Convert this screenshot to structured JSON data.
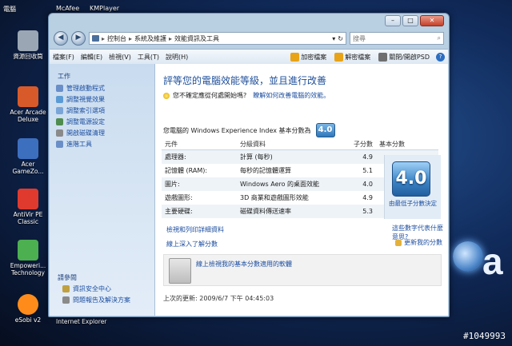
{
  "desktop": {
    "top_labels": [
      "電腦",
      "McAfee",
      "KMPlayer"
    ],
    "icons": [
      {
        "label": "資源回收筒",
        "color": "#9aa6b3"
      },
      {
        "label": "Acer Arcade Deluxe",
        "color": "#d85a2a"
      },
      {
        "label": "Acer GameZo...",
        "color": "#3d6fbf"
      },
      {
        "label": "AntiVir PE Classic",
        "color": "#e03a2f"
      },
      {
        "label": "Empoweri... Technology",
        "color": "#4caf50"
      },
      {
        "label": "eSobi v2",
        "color": "#ff8c1a"
      }
    ],
    "bottom_icon_label": "Internet Explorer",
    "watermark": "#1049993"
  },
  "window": {
    "address": {
      "crumbs": [
        "控制台",
        "系統及維護",
        "效能資訊及工具"
      ],
      "search_placeholder": "搜尋"
    },
    "menu": [
      "檔案(F)",
      "編輯(E)",
      "檢視(V)",
      "工具(T)",
      "說明(H)"
    ],
    "toolbar": [
      {
        "label": "加密檔案",
        "color": "#e8a317"
      },
      {
        "label": "解密檔案",
        "color": "#e8a317"
      },
      {
        "label": "關閉/開啟PSD",
        "color": "#6f6f6f"
      }
    ],
    "sidebar": {
      "title": "工作",
      "links": [
        {
          "label": "管理啟動程式",
          "color": "#6a8fc8"
        },
        {
          "label": "調整視覺效果",
          "color": "#5b9bd5"
        },
        {
          "label": "調整索引選項",
          "color": "#7aa5d8"
        },
        {
          "label": "調整電源設定",
          "color": "#4f8c4f"
        },
        {
          "label": "開啟磁碟清理",
          "color": "#8a8a8a"
        },
        {
          "label": "進階工具",
          "color": "#6a8fc8"
        }
      ],
      "see_also_title": "請參閱",
      "bottom_links": [
        {
          "label": "資訊安全中心",
          "color": "#c0a040"
        },
        {
          "label": "問題報告及解決方案",
          "color": "#8a8a8a"
        }
      ]
    },
    "main": {
      "heading": "評等您的電腦效能等級，並且進行改善",
      "hint_text": "您不確定應從何處開始嗎?",
      "hint_link": "瞭解如何改善電腦的效能。",
      "wei_label": "您電腦的 Windows Experience Index 基本分數為",
      "wei_score": "4.0",
      "table": {
        "headers": [
          "元件",
          "分級資料",
          "子分數",
          "基本分數"
        ],
        "rows": [
          {
            "component": "處理器:",
            "rating": "計算 (每秒)",
            "subscore": "4.9"
          },
          {
            "component": "記憶體 (RAM):",
            "rating": "每秒的記憶體運算",
            "subscore": "5.1"
          },
          {
            "component": "圖片:",
            "rating": "Windows Aero 的桌面效能",
            "subscore": "4.0"
          },
          {
            "component": "遊戲圖形:",
            "rating": "3D 商業和遊戲圖形效能",
            "subscore": "4.9"
          },
          {
            "component": "主要硬碟:",
            "rating": "磁碟資料傳送速率",
            "subscore": "5.3"
          }
        ]
      },
      "base_score": "4.0",
      "base_note": "由最低子分數決定",
      "link_print": "檢視和列印詳細資料",
      "link_more": "線上深入了解分數",
      "link_mean": "這些數字代表什麼意思?",
      "link_update": "更新我的分數",
      "info_text": "線上檢視我的基本分數適用的軟體",
      "last_updated": "上次的更新: 2009/6/7 下午 04:45:03"
    }
  }
}
